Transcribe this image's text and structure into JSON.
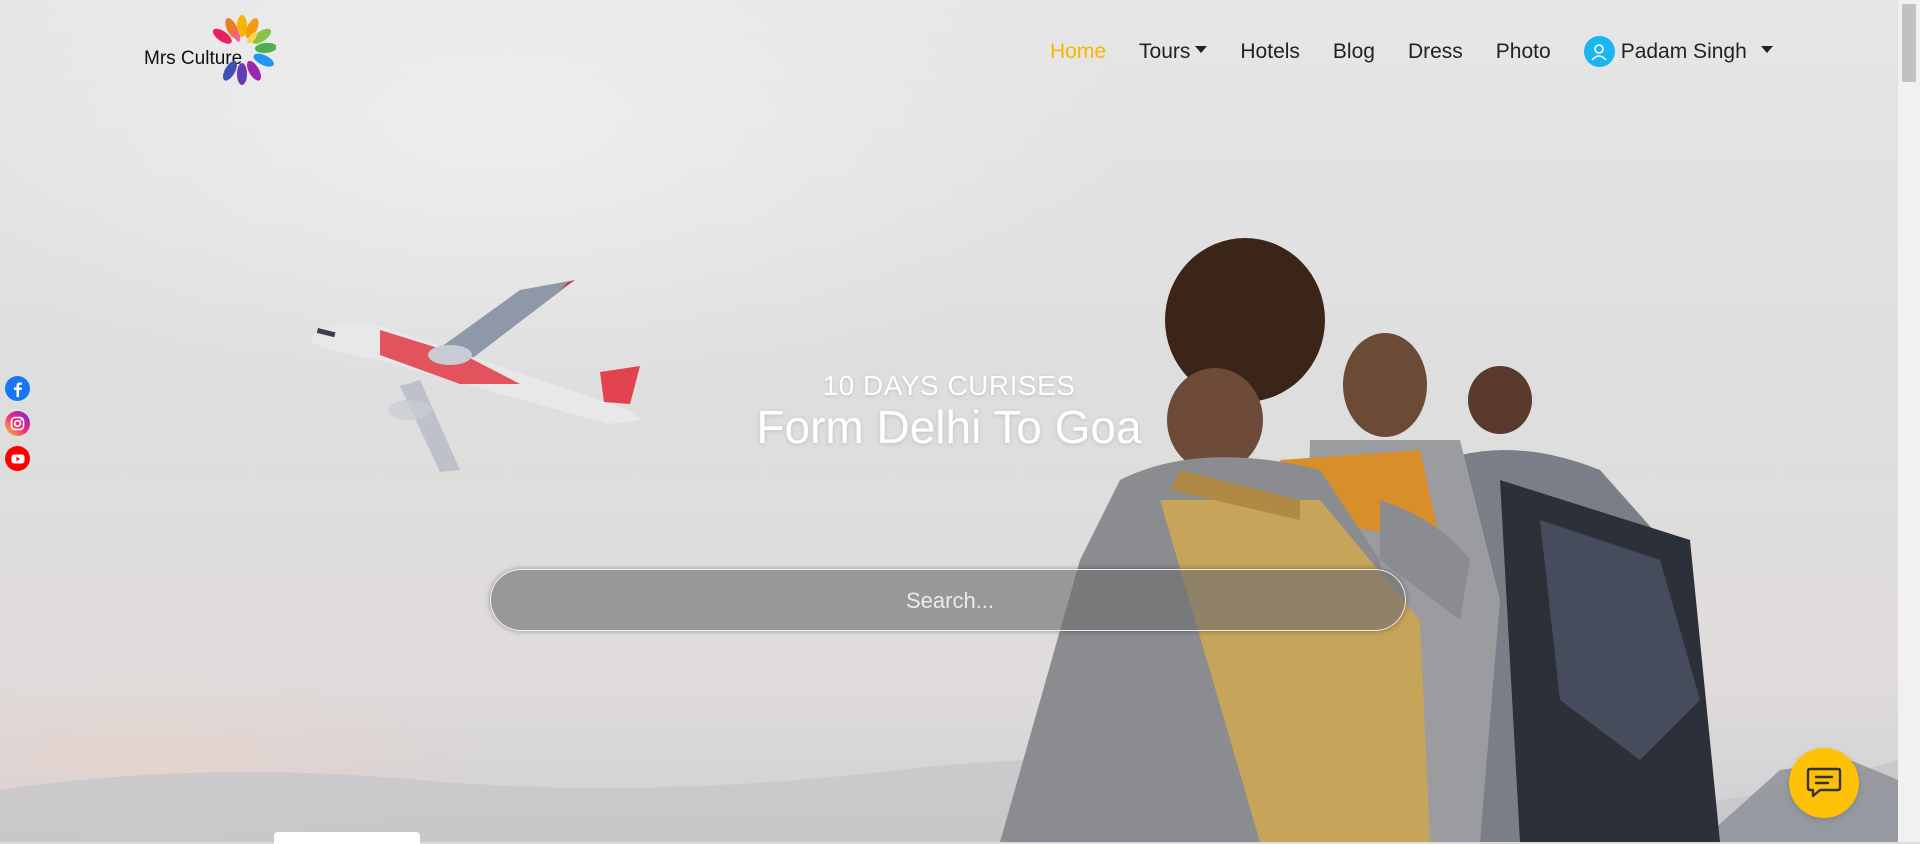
{
  "brand": {
    "name": "Mrs Culture",
    "logo_icon": "lotus-petals-icon"
  },
  "nav": {
    "items": [
      {
        "label": "Home",
        "active": true,
        "dropdown": false
      },
      {
        "label": "Tours",
        "active": false,
        "dropdown": true
      },
      {
        "label": "Hotels",
        "active": false,
        "dropdown": false
      },
      {
        "label": "Blog",
        "active": false,
        "dropdown": false
      },
      {
        "label": "Dress",
        "active": false,
        "dropdown": false
      },
      {
        "label": "Photo",
        "active": false,
        "dropdown": false
      }
    ],
    "user": {
      "name": "Padam Singh",
      "icon": "user-avatar-icon"
    }
  },
  "hero": {
    "subtitle": "10 DAYS CURISES",
    "title": "Form Delhi To Goa"
  },
  "search": {
    "placeholder": "Search...",
    "value": ""
  },
  "social": [
    {
      "name": "facebook",
      "icon": "facebook-icon"
    },
    {
      "name": "instagram",
      "icon": "instagram-icon"
    },
    {
      "name": "youtube",
      "icon": "youtube-icon"
    }
  ],
  "chat": {
    "icon": "chat-bubble-icon"
  },
  "colors": {
    "accent": "#f7b500",
    "avatar": "#19b6f0",
    "chat_button": "#ffc107",
    "facebook": "#1877f2",
    "youtube": "#ff0000"
  }
}
